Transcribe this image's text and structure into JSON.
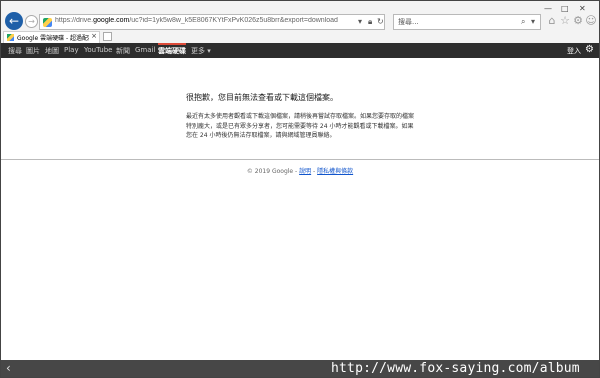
{
  "browser": {
    "url_prefix": "https://drive.",
    "url_domain": "google.com",
    "url_rest": "/uc?id=1yk5w8w_k5E8067KYtFxPvK026z5u8brr&export=download",
    "search_placeholder": "搜尋...",
    "tab_title": "Google 雲端硬碟 - 超過配額"
  },
  "gbar": {
    "items": [
      "搜尋",
      "圖片",
      "地圖",
      "Play",
      "YouTube",
      "新聞",
      "Gmail",
      "雲端硬碟",
      "更多 ▾"
    ],
    "login": "登入"
  },
  "message": {
    "title": "很抱歉，您目前無法查看或下載這個檔案。",
    "body": "最近有太多使用者觀看或下載這個檔案，請稍後再嘗試存取檔案。如果您要存取的檔案特別龐大，或是已有眾多分享者，您可能需要等待 24 小時才能觀看或下載檔案。如果您在 24 小時後仍無法存取檔案，請與網域管理員聯絡。"
  },
  "footer": {
    "copyright": "© 2019 Google - ",
    "help": "說明",
    "sep": " - ",
    "privacy": "隱私權與條款"
  },
  "watermark": "http://www.fox-saying.com/album"
}
